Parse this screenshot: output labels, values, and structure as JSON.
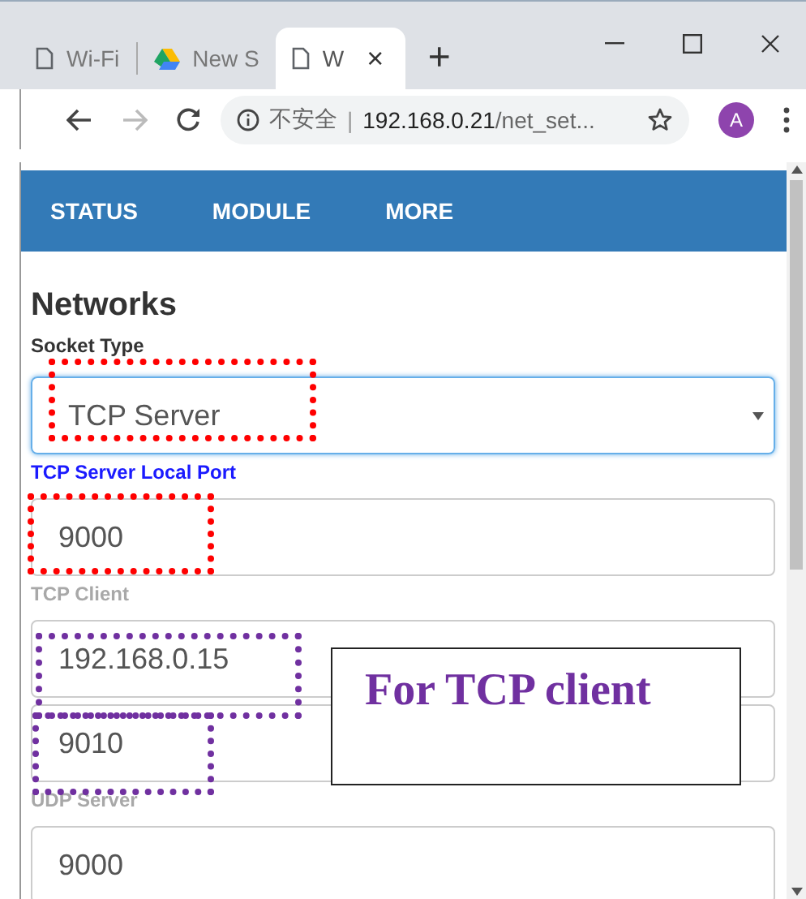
{
  "browser": {
    "tabs": [
      {
        "title": "Wi-Fi",
        "selected": false
      },
      {
        "title": "New S",
        "selected": false
      },
      {
        "title": "W",
        "selected": true,
        "close": "×"
      }
    ],
    "new_tab": "+",
    "security": "不安全",
    "separator": "|",
    "url_host": "192.168.0.21",
    "url_path": "/net_set...",
    "avatar": "A"
  },
  "nav": [
    {
      "label": "STATUS"
    },
    {
      "label": "MODULE"
    },
    {
      "label": "MORE"
    }
  ],
  "heading": "Networks",
  "fields": [
    {
      "kind": "label",
      "text": "Socket Type",
      "active": false,
      "disabled": false
    },
    {
      "kind": "select",
      "value": "TCP Server",
      "focused": true
    },
    {
      "kind": "label",
      "text": "TCP Server Local Port",
      "active": true,
      "disabled": false
    },
    {
      "kind": "input",
      "value": "9000"
    },
    {
      "kind": "label",
      "text": "TCP Client",
      "active": false,
      "disabled": true
    },
    {
      "kind": "input",
      "value": "192.168.0.15"
    },
    {
      "kind": "input",
      "value": "9010"
    },
    {
      "kind": "label",
      "text": "UDP Server",
      "active": false,
      "disabled": true
    },
    {
      "kind": "input",
      "value": "9000"
    }
  ],
  "highlights": [
    {
      "color": "#ff0000"
    },
    {
      "color": "#ff0000"
    },
    {
      "color": "#7030a0"
    },
    {
      "color": "#7030a0"
    }
  ],
  "callout": "For TCP client"
}
